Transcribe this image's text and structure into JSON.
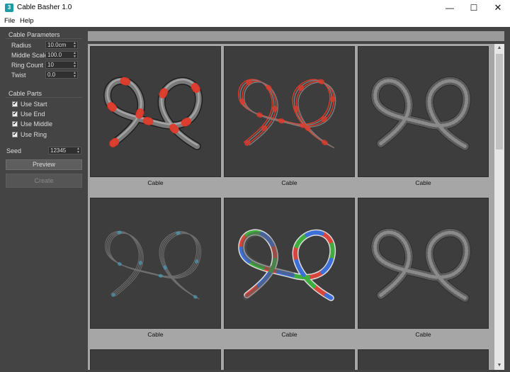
{
  "window": {
    "title": "Cable Basher 1.0",
    "app_icon_glyph": "3",
    "minimize_glyph": "—",
    "maximize_glyph": "☐",
    "close_glyph": "✕"
  },
  "menu": {
    "items": [
      "File",
      "Help"
    ]
  },
  "cable_parameters": {
    "title": "Cable Parameters",
    "params": [
      {
        "label": "Radius",
        "value": "10.0cm"
      },
      {
        "label": "Middle Scale",
        "value": "100.0"
      },
      {
        "label": "Ring Count",
        "value": "10"
      },
      {
        "label": "Twist",
        "value": "0.0"
      }
    ]
  },
  "cable_parts": {
    "title": "Cable Parts",
    "checkbox_glyph": "✔",
    "items": [
      {
        "label": "Use Start",
        "checked": true
      },
      {
        "label": "Use End",
        "checked": true
      },
      {
        "label": "Use Middle",
        "checked": true
      },
      {
        "label": "Use Ring",
        "checked": true
      }
    ]
  },
  "seed": {
    "label": "Seed",
    "value": "12345"
  },
  "buttons": {
    "preview": "Preview",
    "create": "Create"
  },
  "previews": [
    {
      "caption": "Cable",
      "style": "rings-red"
    },
    {
      "caption": "Cable",
      "style": "wire-red"
    },
    {
      "caption": "Cable",
      "style": "coiled"
    },
    {
      "caption": "Cable",
      "style": "wire-thin"
    },
    {
      "caption": "Cable",
      "style": "rgb-segments"
    },
    {
      "caption": "Cable",
      "style": "coiled"
    }
  ],
  "colors": {
    "panel_bg": "#444444",
    "grid_bg": "#a6a6a6",
    "thumb_bg": "#3d3d3d",
    "accent_red": "#e03a2a",
    "seg_red": "#d8453a",
    "seg_green": "#3fae3f",
    "seg_blue": "#3d6fd8"
  }
}
